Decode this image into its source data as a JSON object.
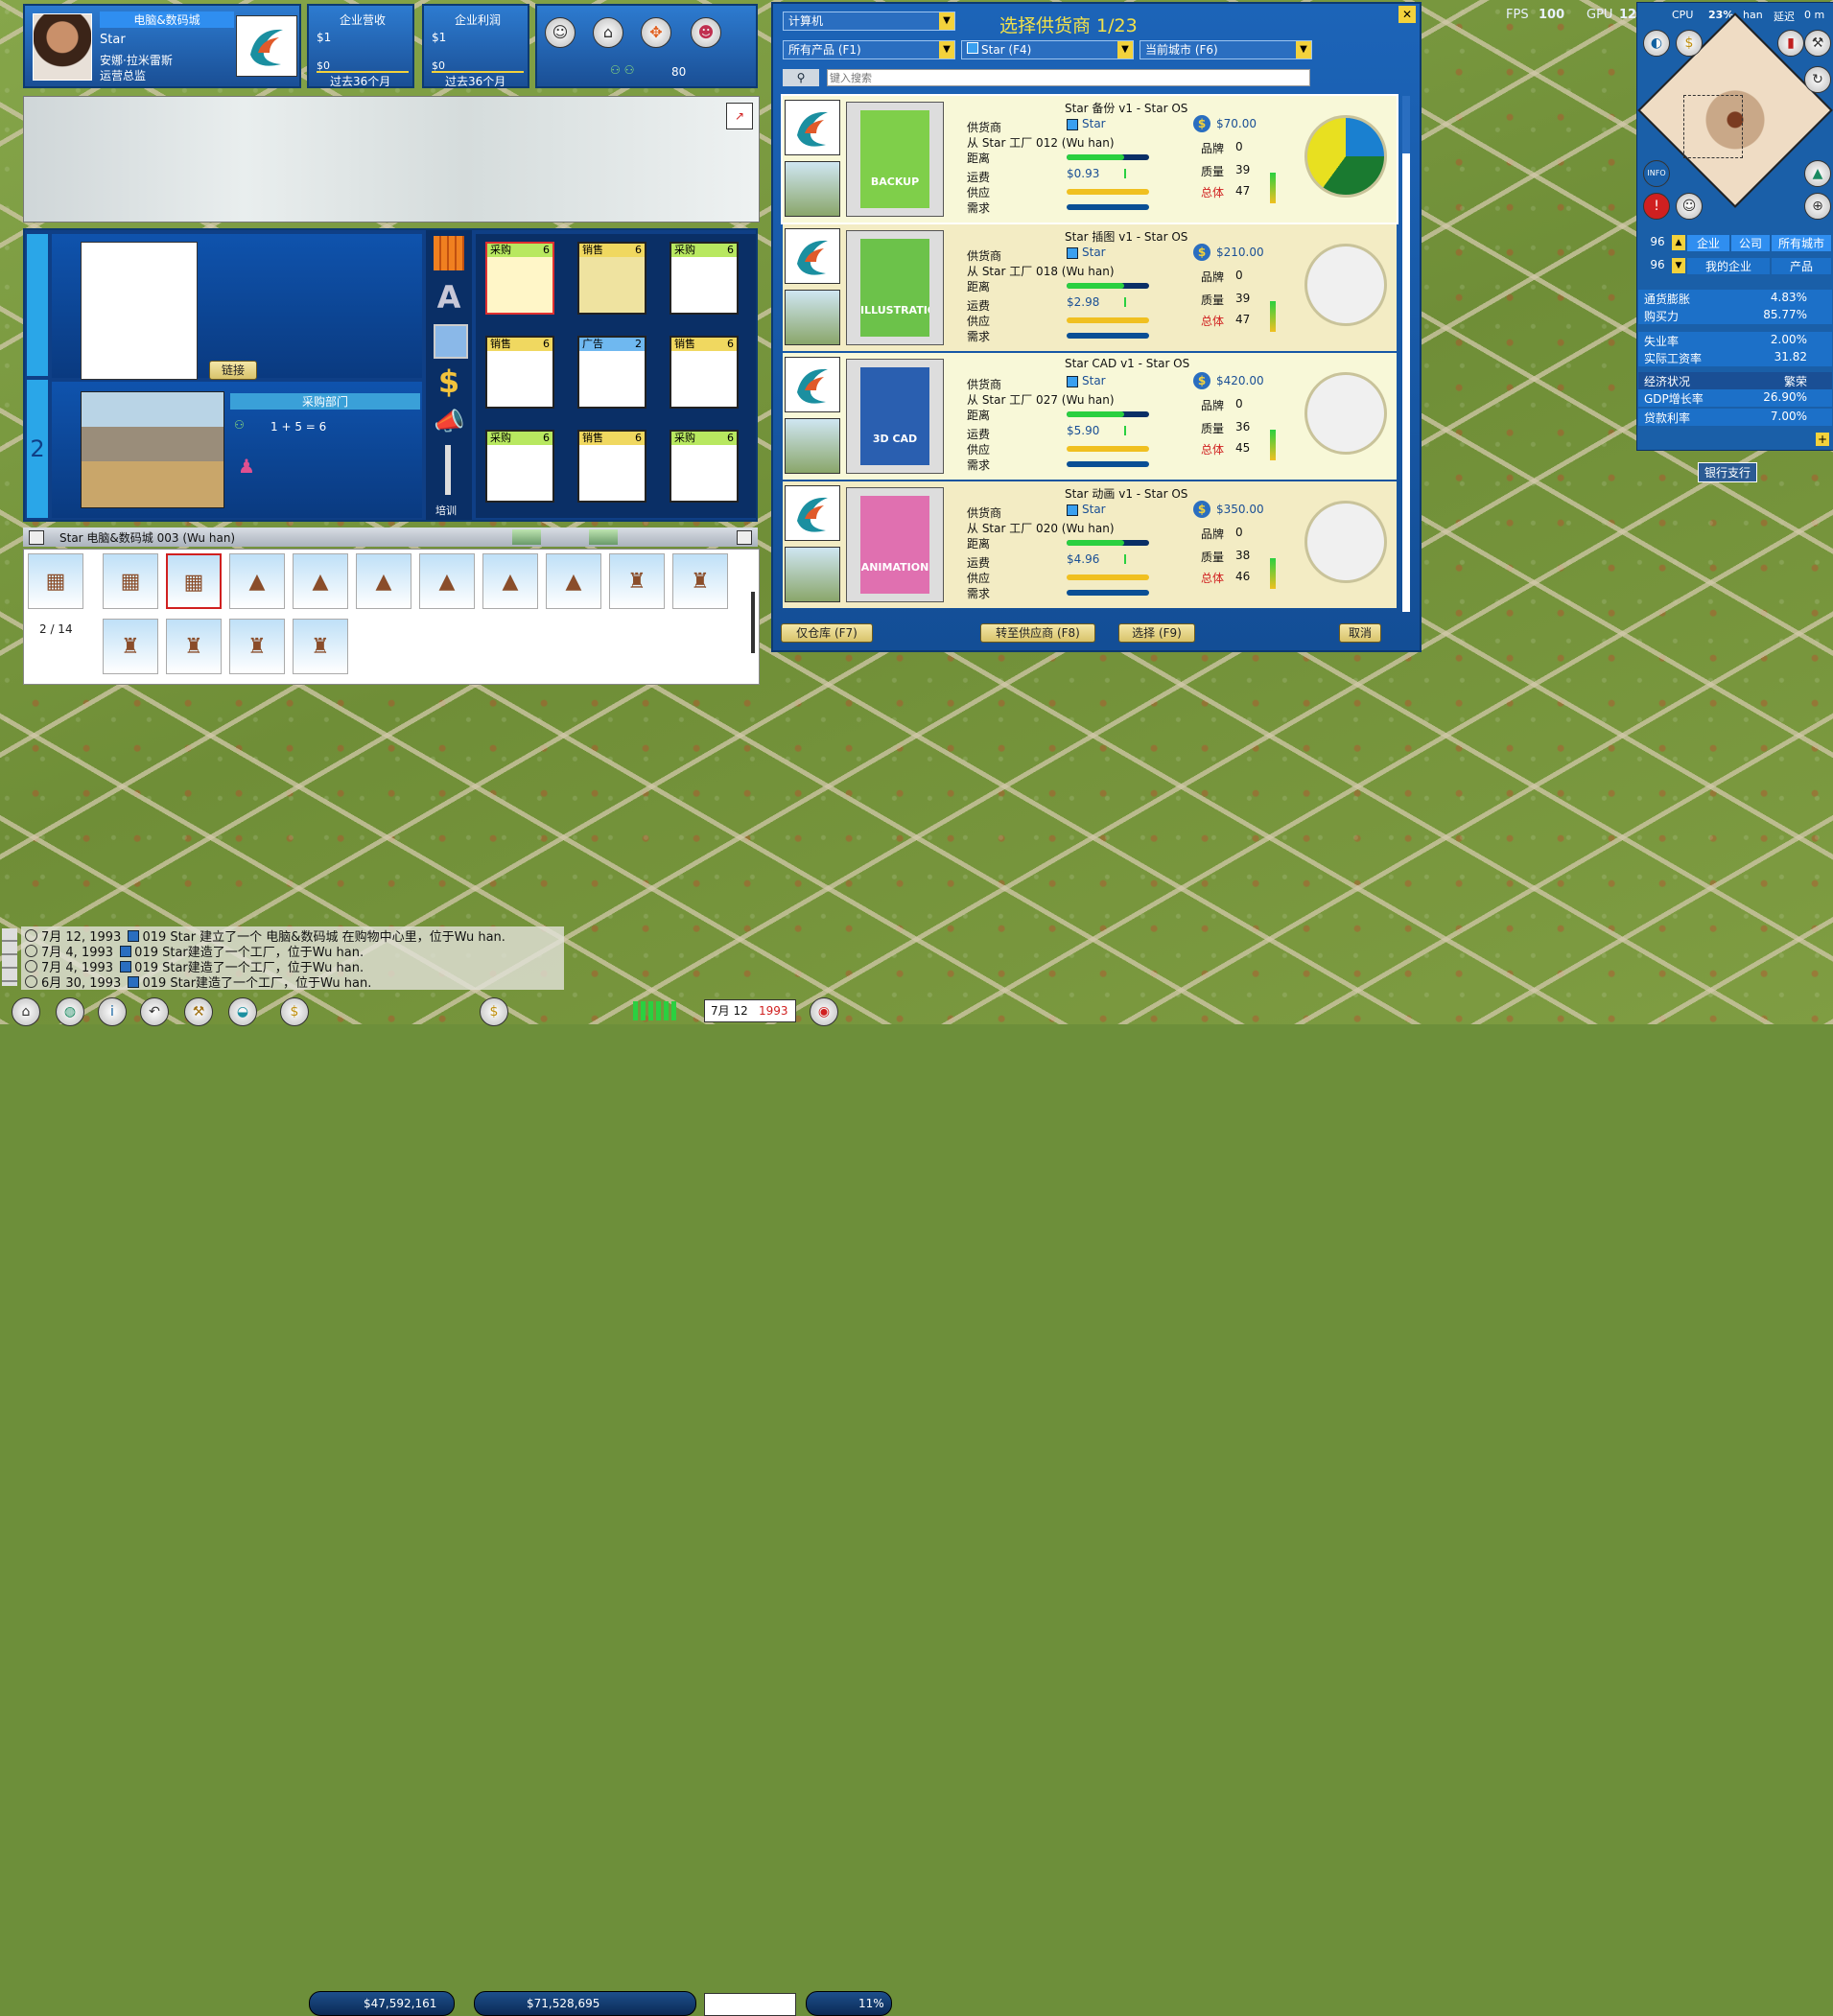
{
  "company_card": {
    "store_type": "电脑&数码城",
    "player": "Star",
    "manager": "安娜·拉米雷斯",
    "role": "运营总监",
    "revenue_label": "企业营收",
    "profit_label": "企业利润",
    "revenue_value": "$1",
    "revenue_zero": "$0",
    "profit_value": "$1",
    "profit_zero": "$0",
    "period": "过去36个月",
    "staff_count": "80"
  },
  "dept_panel": {
    "link_button": "链接",
    "dept_name": "采购部门",
    "formula": "1 + 5 = 6",
    "training_label": "培训",
    "footer_title": "Star 电脑&数码城 003 (Wu han)",
    "page_indicator": "2 / 14"
  },
  "unit_grid": [
    {
      "name": "采购",
      "level": "6",
      "color": "#fff6c8",
      "header": "#b8e860"
    },
    {
      "name": "销售",
      "level": "6",
      "color": "#efe3a0",
      "header": "#f0d860"
    },
    {
      "name": "采购",
      "level": "6",
      "color": "#ffffff",
      "header": "#b8e860"
    },
    {
      "name": "销售",
      "level": "6",
      "color": "#ffffff",
      "header": "#f0d860"
    },
    {
      "name": "广告",
      "level": "2",
      "color": "#ffffff",
      "header": "#6fb8f0"
    },
    {
      "name": "销售",
      "level": "6",
      "color": "#ffffff",
      "header": "#f0d860"
    },
    {
      "name": "采购",
      "level": "6",
      "color": "#ffffff",
      "header": "#b8e860"
    },
    {
      "name": "销售",
      "level": "6",
      "color": "#ffffff",
      "header": "#f0d860"
    },
    {
      "name": "采购",
      "level": "6",
      "color": "#ffffff",
      "header": "#b8e860"
    }
  ],
  "supplier_dialog": {
    "category": "计算机",
    "title": "选择供货商 1/23",
    "filter_product": "所有产品 (F1)",
    "filter_company": "Star (F4)",
    "filter_city": "当前城市 (F6)",
    "search_placeholder": "键入搜索",
    "labels": {
      "supplier": "供货商",
      "distance": "距离",
      "freight": "运费",
      "supply": "供应",
      "demand": "需求",
      "brand": "品牌",
      "quality": "质量",
      "total": "总体"
    },
    "items": [
      {
        "title": "Star 备份 v1 - Star OS",
        "supplier": "Star",
        "from": "从 Star 工厂 012 (Wu han)",
        "price": "$70.00",
        "freight": "$0.93",
        "brand": "0",
        "quality": "39",
        "total": "47",
        "cover_text": "BACKUP",
        "cover_color": "#7fcf4a",
        "pie": true,
        "bg": "#f8f8d8"
      },
      {
        "title": "Star 插图 v1 - Star OS",
        "supplier": "Star",
        "from": "从 Star 工厂 018 (Wu han)",
        "price": "$210.00",
        "freight": "$2.98",
        "brand": "0",
        "quality": "39",
        "total": "47",
        "cover_text": "ILLUSTRATION",
        "cover_color": "#6cc24a",
        "pie": false,
        "bg": "#f3ecc4"
      },
      {
        "title": "Star CAD v1 - Star OS",
        "supplier": "Star",
        "from": "从 Star 工厂 027 (Wu han)",
        "price": "$420.00",
        "freight": "$5.90",
        "brand": "0",
        "quality": "36",
        "total": "45",
        "cover_text": "3D CAD",
        "cover_color": "#2a5fb0",
        "pie": false,
        "bg": "#f8f8d8"
      },
      {
        "title": "Star 动画 v1 - Star OS",
        "supplier": "Star",
        "from": "从 Star 工厂 020 (Wu han)",
        "price": "$350.00",
        "freight": "$4.96",
        "brand": "0",
        "quality": "38",
        "total": "46",
        "cover_text": "ANIMATION",
        "cover_color": "#e070b0",
        "pie": false,
        "bg": "#f3ecc4"
      }
    ],
    "btn_warehouse": "仅仓库 (F7)",
    "btn_goto": "转至供应商 (F8)",
    "btn_select": "选择 (F9)",
    "btn_cancel": "取消"
  },
  "perf": {
    "fps_label": "FPS",
    "fps_value": "100",
    "gpu_label": "GPU",
    "gpu_value": "12",
    "cpu_label": "CPU",
    "cpu_value": "23",
    "city": "han",
    "delay_label": "延迟",
    "delay_value": "0"
  },
  "minimap": {
    "info_label": "INFO",
    "counter_a": "96",
    "counter_b": "96",
    "tab_enterprise": "企业",
    "tab_company": "公司",
    "tab_all_cities": "所有城市",
    "tab_my_enterprise": "我的企业",
    "tab_product": "产品"
  },
  "economy": [
    {
      "label": "通货膨胀",
      "value": "4.83%"
    },
    {
      "label": "购买力",
      "value": "85.77%"
    },
    {
      "label": "失业率",
      "value": "2.00%"
    },
    {
      "label": "实际工资率",
      "value": "31.82"
    },
    {
      "label": "经济状况",
      "value": "繁荣"
    },
    {
      "label": "GDP增长率",
      "value": "26.90%"
    },
    {
      "label": "贷款利率",
      "value": "7.00%"
    }
  ],
  "map_label": "银行支行",
  "news": [
    {
      "date": "7月 12, 1993",
      "text": "019 Star 建立了一个 电脑&数码城 在购物中心里，位于Wu han."
    },
    {
      "date": "7月 4, 1993",
      "text": "019 Star建造了一个工厂，位于Wu han."
    },
    {
      "date": "7月 4, 1993",
      "text": "019 Star建造了一个工厂，位于Wu han."
    },
    {
      "date": "6月 30, 1993",
      "text": "019 Star建造了一个工厂，位于Wu han."
    }
  ],
  "taskbar": {
    "cash": "$47,592,161",
    "net_worth": "$71,528,695",
    "month_day": "7月 12",
    "year": "1993",
    "percent": "11%"
  }
}
